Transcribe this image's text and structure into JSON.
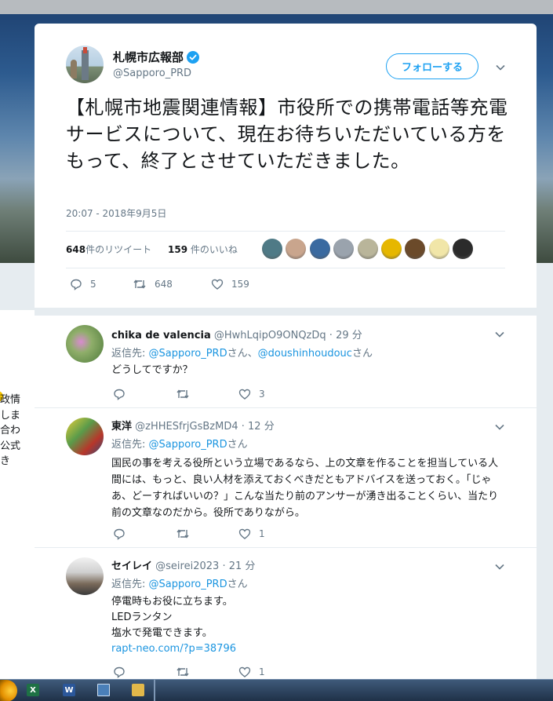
{
  "background": {
    "side_text_lines": [
      "政情",
      "しま",
      "合わ",
      "公式",
      "き"
    ]
  },
  "tweet": {
    "display_name": "札幌市広報部",
    "handle": "@Sapporo_PRD",
    "follow_label": "フォローする",
    "text": "【札幌市地震関連情報】市役所での携帯電話等充電サービスについて、現在お待ちいただいている方をもって、終了とさせていただきました。",
    "timestamp": "20:07 - 2018年9月5日",
    "retweets_count": "648",
    "retweets_label": "件のリツイート",
    "likes_count": "159",
    "likes_label": " 件のいいね",
    "liker_colors": [
      "#4f7a86",
      "#c9a58d",
      "#3a6aa0",
      "#9aa3ad",
      "#b9b59a",
      "#e6b700",
      "#6b4a2a",
      "#f1e6a8",
      "#2b2b2b"
    ],
    "actions": {
      "reply_count": "5",
      "retweet_count": "648",
      "like_count": "159"
    }
  },
  "replies": [
    {
      "name": "chika de valencia",
      "handle": "@HwhLqipO9ONQzDq",
      "time": "29 分",
      "reply_to_label": "返信先: ",
      "reply_to_1": "@Sapporo_PRD",
      "reply_to_sep": "さん、",
      "reply_to_2": "@doushinhoudouc",
      "reply_to_suffix": "さん",
      "text": "どうしてですか？",
      "reply_count": "",
      "retweet_count": "",
      "like_count": "3"
    },
    {
      "name": "東洋",
      "handle": "@zHHESfrjGsBzMD4",
      "time": "12 分",
      "reply_to_label": "返信先: ",
      "reply_to_1": "@Sapporo_PRD",
      "reply_to_suffix": "さん",
      "text": "国民の事を考える役所という立場であるなら、上の文章を作ることを担当している人間には、もっと、良い人材を添えておくべきだともアドバイスを送っておく。「じゃあ、どーすればいいの？」こんな当たり前のアンサーが湧き出ることくらい、当たり前の文章なのだから。役所でありながら。",
      "reply_count": "",
      "retweet_count": "",
      "like_count": "1"
    },
    {
      "name": "セイレイ",
      "handle": "@seirei2023",
      "time": "21 分",
      "reply_to_label": "返信先: ",
      "reply_to_1": "@Sapporo_PRD",
      "reply_to_suffix": "さん",
      "text_lines": [
        "停電時もお役に立ちます。",
        "LEDランタン",
        "塩水で発電できます。"
      ],
      "link": "rapt-neo.com/?p=38796",
      "reply_count": "",
      "retweet_count": "",
      "like_count": "1"
    }
  ],
  "taskbar": {
    "excel_label": "X",
    "word_label": "W"
  }
}
